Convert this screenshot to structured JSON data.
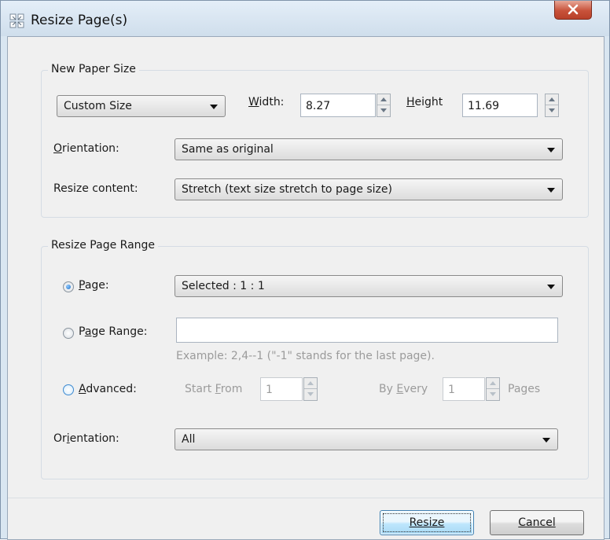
{
  "window": {
    "title": "Resize Page(s)",
    "close_symbol": "X"
  },
  "paper": {
    "group_title": "New Paper Size",
    "size_select": "Custom Size",
    "width_label": "Width:",
    "width_value": "8.27",
    "height_label": "Height",
    "height_value": "11.69",
    "orientation_label": "Orientation:",
    "orientation_value": "Same as original",
    "resize_label": "Resize content:",
    "resize_value": "Stretch (text size stretch to page size)"
  },
  "range": {
    "group_title": "Resize Page Range",
    "page_label": "Page:",
    "page_value": "Selected : 1 : 1",
    "page_range_label": "Page Range:",
    "page_range_value": "",
    "example": "Example: 2,4--1 (\"-1\" stands for the last page).",
    "advanced_label": "Advanced:",
    "start_from_label": "Start From",
    "start_from_value": "1",
    "by_every_label": "By Every",
    "by_every_value": "1",
    "pages_label": "Pages",
    "orientation_label": "Orientation:",
    "orientation_value": "All"
  },
  "buttons": {
    "resize": "Resize",
    "cancel": "Cancel"
  }
}
